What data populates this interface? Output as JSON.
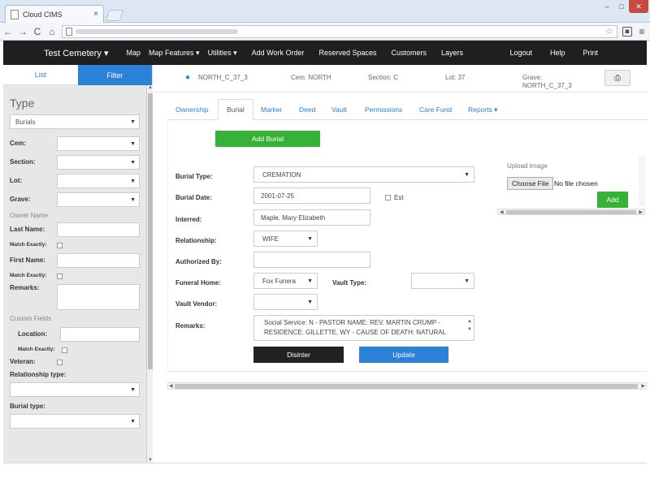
{
  "browser": {
    "tab_title": "Cloud CIMS",
    "close_glyph": "×",
    "win_min": "–",
    "win_max": "□",
    "win_close": "✕"
  },
  "nav": {
    "brand": "Test Cemetery ▾",
    "items": [
      "Map",
      "Map Features ▾",
      "Utilities ▾",
      "Add Work Order",
      "Reserved Spaces",
      "Customers",
      "Layers"
    ],
    "right": [
      "Logout",
      "Help",
      "Print"
    ]
  },
  "sidebar": {
    "tab_list": "List",
    "tab_filter": "Filter",
    "title": "Type",
    "type_value": "Burials",
    "cem": "Cem:",
    "section": "Section:",
    "lot": "Lot:",
    "grave": "Grave:",
    "owner_name": "Owner Name",
    "last_name": "Last Name:",
    "match_exactly": "Match Exactly:",
    "first_name": "First Name:",
    "remarks": "Remarks:",
    "custom_fields": "Custom Fields",
    "location": "Location:",
    "veteran": "Veteran:",
    "relationship_type": "Relationship type:",
    "burial_type": "Burial type:"
  },
  "header": {
    "grave_id": "NORTH_C_37_3",
    "cem": "Cem: NORTH",
    "section": "Section: C",
    "lot": "Lot: 37",
    "grave": "Grave: NORTH_C_37_3"
  },
  "tabs": {
    "ownership": "Ownership",
    "burial": "Burial",
    "marker": "Marker",
    "deed": "Deed",
    "vault": "Vault",
    "permissions": "Permissions",
    "care_fund": "Care Fund",
    "reports": "Reports ▾"
  },
  "form": {
    "add_burial": "Add Burial",
    "burial_type_label": "Burial Type:",
    "burial_type_value": "CREMATION",
    "burial_date_label": "Burial Date:",
    "burial_date_value": "2001-07-25",
    "est_label": "Est",
    "interred_label": "Interred:",
    "interred_value": "Maple, Mary Elizabeth",
    "relationship_label": "Relationship:",
    "relationship_value": "WIFE",
    "authorized_label": "Authorized By:",
    "authorized_value": "",
    "funeral_home_label": "Funeral Home:",
    "funeral_home_value": "Fox Funera",
    "vault_type_label": "Vault Type:",
    "vault_vendor_label": "Vault Vendor:",
    "remarks_label": "Remarks:",
    "remarks_value": "Social Service: N - PASTOR NAME: REV. MARTIN CRUMP - RESIDENCE: GILLETTE, WY - CAUSE OF DEATH: NATURAL",
    "disinter": "Disinter",
    "update": "Update"
  },
  "upload": {
    "label": "Upload Image",
    "choose": "Choose File",
    "no_file": "No file chosen",
    "add": "Add"
  },
  "colors": {
    "accent_blue": "#2c82d9",
    "green": "#36b336",
    "navbar": "#1f1f1f"
  }
}
